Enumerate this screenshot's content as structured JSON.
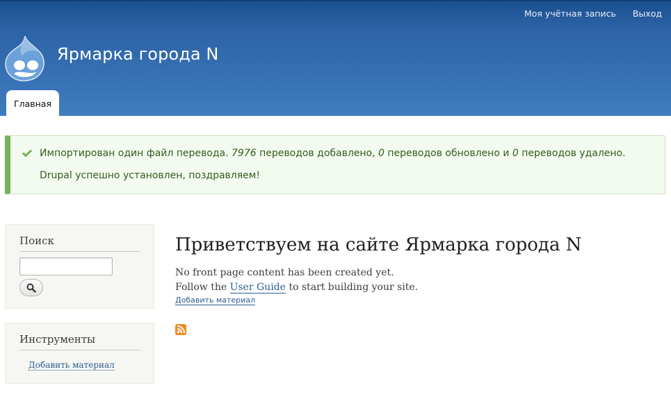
{
  "header": {
    "site_name": "Ярмарка города N",
    "secondary_menu": {
      "account": "Моя учётная запись",
      "logout": "Выход"
    },
    "main_menu": {
      "home": "Главная"
    },
    "colors": {
      "header_top": "#1a4f8e",
      "header_bottom": "#3f7cc0"
    }
  },
  "messages": {
    "line1_a": "Импортирован один файл перевода. ",
    "line1_num1": "7976",
    "line1_b": " переводов добавлено, ",
    "line1_num2": "0",
    "line1_c": " переводов обновлено и ",
    "line1_num3": "0",
    "line1_d": " переводов удалено.",
    "line2": "Drupal успешно установлен, поздравляем!",
    "icon": "check-icon",
    "color": "#77b259"
  },
  "sidebar": {
    "search": {
      "title": "Поиск",
      "input_value": "",
      "button_icon": "search-icon"
    },
    "tools": {
      "title": "Инструменты",
      "link": "Добавить материал"
    }
  },
  "main": {
    "title": "Приветствуем на сайте Ярмарка города N",
    "line1": "No front page content has been created yet.",
    "line2_before": "Follow the ",
    "line2_link": "User Guide",
    "line2_after": " to start building your site.",
    "add_link": "Добавить материал",
    "feed_icon": "rss-feed-icon"
  }
}
